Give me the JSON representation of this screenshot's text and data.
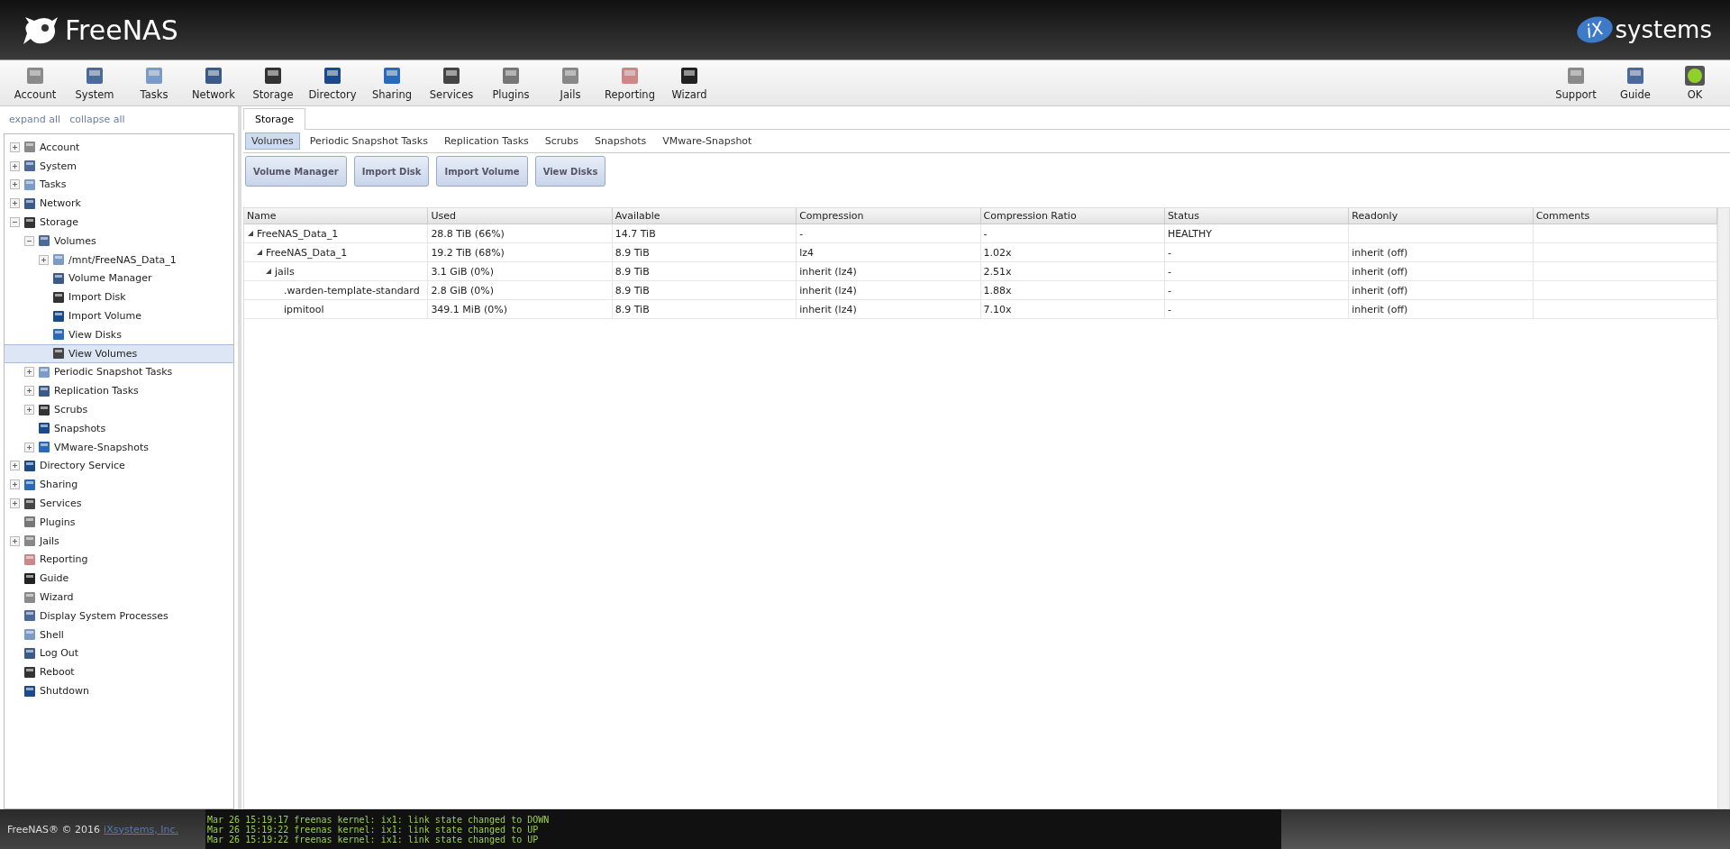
{
  "header": {
    "product": "FreeNAS",
    "vendor_mark": "iX",
    "vendor_name": "systems"
  },
  "toolbar": {
    "left": [
      {
        "label": "Account"
      },
      {
        "label": "System"
      },
      {
        "label": "Tasks"
      },
      {
        "label": "Network"
      },
      {
        "label": "Storage"
      },
      {
        "label": "Directory"
      },
      {
        "label": "Sharing"
      },
      {
        "label": "Services"
      },
      {
        "label": "Plugins"
      },
      {
        "label": "Jails"
      },
      {
        "label": "Reporting"
      },
      {
        "label": "Wizard"
      }
    ],
    "right": [
      {
        "label": "Support"
      },
      {
        "label": "Guide"
      },
      {
        "label": "OK"
      }
    ]
  },
  "sidebar": {
    "links": [
      "expand all",
      "collapse all"
    ],
    "items": [
      {
        "label": "Account",
        "expanded": false,
        "selected": false
      },
      {
        "label": "System",
        "expanded": false,
        "selected": false
      },
      {
        "label": "Tasks",
        "expanded": false,
        "selected": false
      },
      {
        "label": "Network",
        "expanded": false,
        "selected": false
      },
      {
        "label": "Storage",
        "expanded": true,
        "selected": false,
        "children": [
          {
            "label": "Volumes",
            "expanded": true,
            "selected": false,
            "children": [
              {
                "label": "/mnt/FreeNAS_Data_1",
                "expanded": false,
                "selected": false
              },
              {
                "label": "Volume Manager",
                "selected": false
              },
              {
                "label": "Import Disk",
                "selected": false
              },
              {
                "label": "Import Volume",
                "selected": false
              },
              {
                "label": "View Disks",
                "selected": false
              },
              {
                "label": "View Volumes",
                "selected": true
              }
            ]
          },
          {
            "label": "Periodic Snapshot Tasks",
            "expanded": false,
            "selected": false
          },
          {
            "label": "Replication Tasks",
            "expanded": false,
            "selected": false
          },
          {
            "label": "Scrubs",
            "expanded": false,
            "selected": false
          },
          {
            "label": "Snapshots",
            "selected": false
          },
          {
            "label": "VMware-Snapshots",
            "expanded": false,
            "selected": false
          }
        ]
      },
      {
        "label": "Directory Service",
        "expanded": false,
        "selected": false
      },
      {
        "label": "Sharing",
        "expanded": false,
        "selected": false
      },
      {
        "label": "Services",
        "expanded": false,
        "selected": false
      },
      {
        "label": "Plugins",
        "selected": false
      },
      {
        "label": "Jails",
        "expanded": false,
        "selected": false
      },
      {
        "label": "Reporting",
        "selected": false
      },
      {
        "label": "Guide",
        "selected": false
      },
      {
        "label": "Wizard",
        "selected": false
      },
      {
        "label": "Display System Processes",
        "selected": false
      },
      {
        "label": "Shell",
        "selected": false
      },
      {
        "label": "Log Out",
        "selected": false
      },
      {
        "label": "Reboot",
        "selected": false
      },
      {
        "label": "Shutdown",
        "selected": false
      }
    ]
  },
  "tabs": [
    {
      "label": "Storage",
      "selected": true
    }
  ],
  "subtabs": [
    {
      "label": "Volumes",
      "selected": true
    },
    {
      "label": "Periodic Snapshot Tasks",
      "selected": false
    },
    {
      "label": "Replication Tasks",
      "selected": false
    },
    {
      "label": "Scrubs",
      "selected": false
    },
    {
      "label": "Snapshots",
      "selected": false
    },
    {
      "label": "VMware-Snapshot",
      "selected": false
    }
  ],
  "buttons": [
    "Volume Manager",
    "Import Disk",
    "Import Volume",
    "View Disks"
  ],
  "table": {
    "columns": [
      "Name",
      "Used",
      "Available",
      "Compression",
      "Compression Ratio",
      "Status",
      "Readonly",
      "Comments"
    ],
    "rows": [
      {
        "cells": [
          "FreeNAS_Data_1",
          "28.8 TiB (66%)",
          "14.7 TiB",
          "-",
          "-",
          "HEALTHY",
          ""
        ],
        "expanded": true,
        "children": [
          {
            "cells": [
              "FreeNAS_Data_1",
              "19.2 TiB (68%)",
              "8.9 TiB",
              "lz4",
              "1.02x",
              "-",
              "inherit (off)"
            ],
            "expanded": true,
            "children": [
              {
                "cells": [
                  "jails",
                  "3.1 GiB (0%)",
                  "8.9 TiB",
                  "inherit (lz4)",
                  "2.51x",
                  "-",
                  "inherit (off)"
                ],
                "expanded": true,
                "children": [
                  {
                    "cells": [
                      ".warden-template-standard",
                      "2.8 GiB (0%)",
                      "8.9 TiB",
                      "inherit (lz4)",
                      "1.88x",
                      "-",
                      "inherit (off)"
                    ]
                  },
                  {
                    "cells": [
                      "ipmitool",
                      "349.1 MiB (0%)",
                      "8.9 TiB",
                      "inherit (lz4)",
                      "7.10x",
                      "-",
                      "inherit (off)"
                    ]
                  }
                ]
              }
            ]
          }
        ]
      }
    ]
  },
  "footer": {
    "copyright": "FreeNAS® © 2016",
    "company": "iXsystems, Inc.",
    "log": [
      "Mar 26 15:19:17 freenas kernel: ix1: link state changed to DOWN",
      "Mar 26 15:19:22 freenas kernel: ix1: link state changed to UP",
      "Mar 26 15:19:22 freenas kernel: ix1: link state changed to UP"
    ]
  }
}
